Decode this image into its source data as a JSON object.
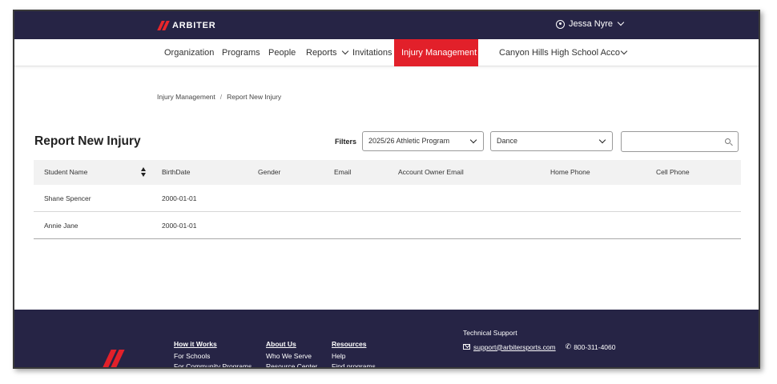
{
  "brand": {
    "name": "ARBITER",
    "accent_color": "#e2202a",
    "header_bg": "#262445"
  },
  "user": {
    "name": "Jessa Nyre",
    "icon": "user-circle-icon"
  },
  "nav": {
    "items": [
      {
        "label": "Organization"
      },
      {
        "label": "Programs"
      },
      {
        "label": "People"
      },
      {
        "label": "Reports"
      },
      {
        "label": "Invitations"
      },
      {
        "label": "Injury Management"
      },
      {
        "label": "Canyon Hills High School Acco"
      }
    ],
    "active": "Injury Management"
  },
  "breadcrumb": {
    "items": [
      "Injury Management",
      "Report New Injury"
    ],
    "separator": "/"
  },
  "page": {
    "title": "Report New Injury"
  },
  "filters": {
    "label": "Filters",
    "program": {
      "value": "2025/26 Athletic Program"
    },
    "sport": {
      "value": "Dance"
    },
    "search": {
      "value": "",
      "placeholder": ""
    }
  },
  "table": {
    "headers": [
      "Student Name",
      "BirthDate",
      "Gender",
      "Email",
      "Account Owner Email",
      "Home Phone",
      "Cell Phone"
    ],
    "rows": [
      [
        "Shane Spencer",
        "2000-01-01",
        "",
        "",
        "",
        "",
        ""
      ],
      [
        "Annie Jane",
        "2000-01-01",
        "",
        "",
        "",
        "",
        ""
      ]
    ]
  },
  "footer": {
    "columns": [
      {
        "heading": "How it Works",
        "links": [
          "For Schools",
          "For Community Programs"
        ]
      },
      {
        "heading": "About Us",
        "links": [
          "Who We Serve",
          "Resource Center"
        ]
      },
      {
        "heading": "Resources",
        "links": [
          "Help",
          "Find programs"
        ]
      }
    ],
    "support": {
      "title": "Technical Support",
      "email": "support@arbitersports.com",
      "phone": "800-311-4060"
    }
  }
}
